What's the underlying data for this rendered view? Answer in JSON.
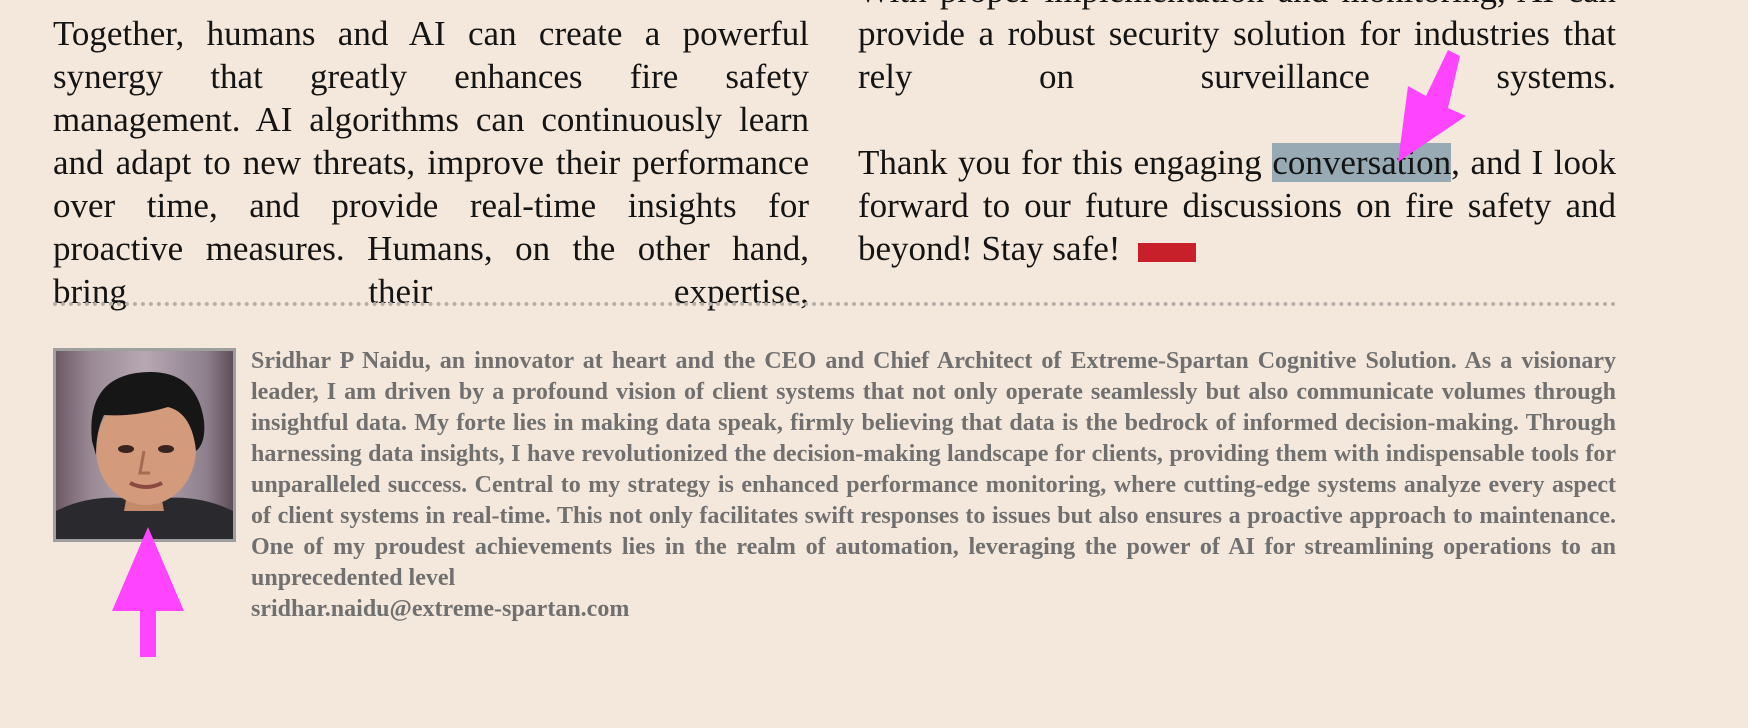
{
  "left_column": {
    "paragraph": "Together, humans and AI can create a powerful synergy that greatly enhances fire safety management. AI algorithms can continuously learn and adapt to new threats, improve their performance over time, and provide real-time insights for proactive measures. Humans, on the other hand, bring their expertise,"
  },
  "right_column": {
    "paragraph1": "With proper implementation and monitoring, AI can provide a robust security solution for industries that rely on surveillance systems.",
    "thank_you_before": "Thank you for this engaging ",
    "thank_you_highlight": "conversation",
    "thank_you_after": ", and I look forward to our future discussions on fire safety and beyond! Stay safe!"
  },
  "author": {
    "bio": "Sridhar P Naidu, an innovator at heart and the CEO and Chief Architect of Extreme-Spartan Cognitive Solution. As a visionary leader, I am driven by a profound vision of client systems that not only operate seamlessly but also communicate volumes through insightful data. My forte lies in making data speak, firmly believing that data is the bedrock of informed decision-making. Through harnessing data insights, I have revolutionized the decision-making landscape for clients, providing them with indispensable tools for unparalleled success. Central to my strategy is enhanced performance monitoring, where cutting-edge systems analyze every aspect of client systems in real-time. This not only facilitates swift responses to issues but also ensures a proactive approach to maintenance. One of my proudest achievements lies in the realm of automation, leveraging the power of AI for streamlining operations to an unprecedented level",
    "email": "sridhar.naidu@extreme-spartan.com"
  },
  "colors": {
    "background": "#f4e8dc",
    "highlight": "#98aab4",
    "end_mark": "#c8202a",
    "arrow": "#ff44ff",
    "bio_text": "#707070"
  }
}
